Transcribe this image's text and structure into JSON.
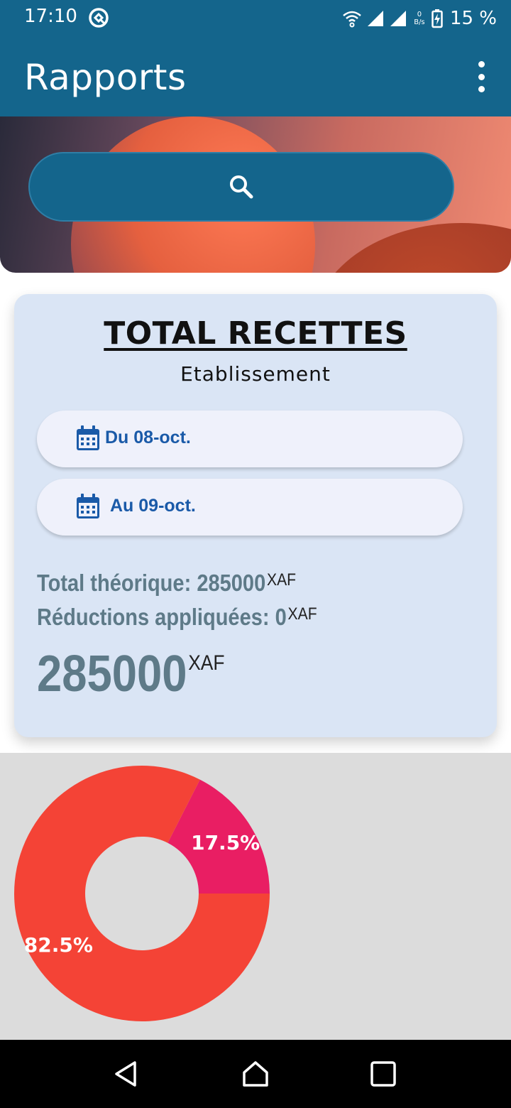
{
  "status_bar": {
    "time": "17:10",
    "net_speed_value": "0",
    "net_speed_unit": "B/s",
    "battery": "15 %"
  },
  "app_bar": {
    "title": "Rapports"
  },
  "card": {
    "title": "TOTAL RECETTES",
    "subtitle": "Etablissement",
    "date_from": "Du 08-oct.",
    "date_to": "Au 09-oct.",
    "total_label": "Total théorique: 285000",
    "reductions_label": "Réductions appliquées: 0",
    "grand_total": "285000",
    "currency": "XAF"
  },
  "chart_data": {
    "type": "pie",
    "donut": true,
    "slices": [
      {
        "label": "82.5%",
        "value": 82.5,
        "color": "#f44336"
      },
      {
        "label": "17.5%",
        "value": 17.5,
        "color": "#e91e63"
      }
    ]
  },
  "colors": {
    "primary": "#14658c",
    "card_bg": "#dae5f5",
    "accent_text": "#1a5aa8",
    "total_text": "#5e7a88"
  },
  "icons": {
    "search": "search-icon",
    "menu": "more-vert-icon",
    "calendar": "calendar-icon"
  }
}
